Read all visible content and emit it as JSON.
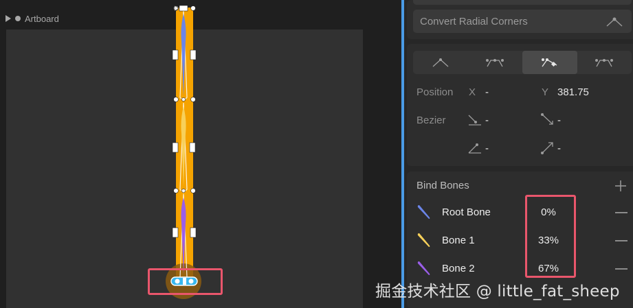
{
  "canvas": {
    "artboard_label": "Artboard",
    "colors": {
      "shape_fill": "#f5a300",
      "bone_blue": "#6b85e8",
      "bone_yellow": "#f7d05a",
      "bone_purple": "#9a5ee8",
      "selection_blue": "#38b8f0",
      "highlight_red": "#e9566c"
    }
  },
  "panel": {
    "convert_button": {
      "label": "Convert Radial Corners",
      "icon": "corner-radius-icon"
    },
    "vertex_modes": [
      {
        "name": "straight-vertex-icon",
        "active": false
      },
      {
        "name": "mirrored-vertex-icon",
        "active": false
      },
      {
        "name": "detached-vertex-icon",
        "active": true
      },
      {
        "name": "asymmetric-vertex-icon",
        "active": false
      }
    ],
    "position": {
      "label": "Position",
      "x_label": "X",
      "x_value": "-",
      "y_label": "Y",
      "y_value": "381.75"
    },
    "bezier": {
      "label": "Bezier",
      "in_x": "-",
      "in_y": "-",
      "out_x": "-",
      "out_y": "-"
    },
    "bind_bones": {
      "title": "Bind Bones",
      "bones": [
        {
          "name": "Root Bone",
          "weight": "0%",
          "color": "#6b85e8"
        },
        {
          "name": "Bone 1",
          "weight": "33%",
          "color": "#f7d05a"
        },
        {
          "name": "Bone 2",
          "weight": "67%",
          "color": "#9a5ee8"
        }
      ]
    }
  },
  "watermark": "掘金技术社区 @ little_fat_sheep"
}
